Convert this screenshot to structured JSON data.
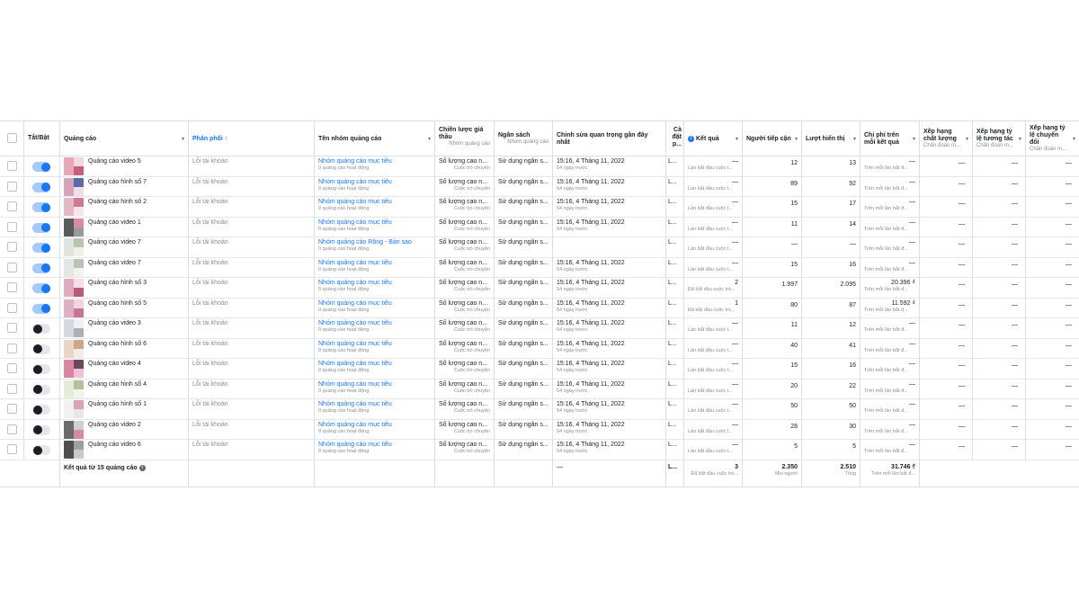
{
  "columns": {
    "toggle": "Tắt/Bật",
    "ad": "Quảng cáo",
    "delivery": "Phân phối ↑",
    "adset": "Tên nhóm quảng cáo",
    "bid": "Chiến lược giá thầu",
    "bid_sub": "Nhóm quảng cáo",
    "budget": "Ngân sách",
    "budget_sub": "Nhóm quảng cáo",
    "edited": "Chỉnh sửa quan trọng gần đây nhất",
    "attr_l1": "Cà",
    "attr_l2": "đặt",
    "attr_l3": "p...",
    "results": "Kết quả",
    "reach": "Người tiếp cận",
    "impressions": "Lượt hiển thị",
    "cpr": "Chi phí trên mỗi kết quả",
    "quality": "Xếp hạng chất lượng",
    "quality_sub": "Chẩn đoán m...",
    "engagement": "Xếp hạng tỷ lệ tương tác",
    "engagement_sub": "Chẩn đoán m...",
    "conversion": "Xếp hạng tỷ lệ chuyển đổi",
    "conversion_sub": "Chẩn đoán m..."
  },
  "common": {
    "delivery": "Lỗi tài khoản",
    "adset_sub": "0 quảng cáo hoạt động",
    "bid": "Số lượng cao n...",
    "bid_sub": "Cuộc trò chuyện",
    "budget": "Sử dụng ngân s...",
    "edited_date": "15:16, 4 Tháng 11, 2022",
    "edited_sub": "54 ngày trước",
    "attr": "L...",
    "results_sub": "Lần bắt đầu cuộc t...",
    "results_sub_alt": "Đã bắt đầu cuộc trò...",
    "cpr_sub": "Trên mỗi lần bắt đ...",
    "dash": "—"
  },
  "rows": [
    {
      "name": "Quảng cáo video 5",
      "on": true,
      "adset": "Nhóm quảng cáo mục tiêu",
      "edited": true,
      "results": "—",
      "alt": false,
      "reach": "12",
      "impr": "13",
      "cpr": "—",
      "t": [
        "#e8a5b4",
        "#f3d7de",
        "#c45f7d"
      ]
    },
    {
      "name": "Quảng cáo hình số 7",
      "on": true,
      "adset": "Nhóm quảng cáo mục tiêu",
      "edited": true,
      "results": "—",
      "alt": false,
      "reach": "89",
      "impr": "92",
      "cpr": "—",
      "t": [
        "#d7a3b8",
        "#5b6aa3",
        "#f0dde5"
      ]
    },
    {
      "name": "Quảng cáo hình số 2",
      "on": true,
      "adset": "Nhóm quảng cáo mục tiêu",
      "edited": true,
      "results": "—",
      "alt": false,
      "reach": "15",
      "impr": "17",
      "cpr": "—",
      "t": [
        "#e6b7c4",
        "#cf7b97",
        "#f5e4ea"
      ]
    },
    {
      "name": "Quảng cáo video 1",
      "on": true,
      "adset": "Nhóm quảng cáo mục tiêu",
      "edited": true,
      "results": "—",
      "alt": false,
      "reach": "11",
      "impr": "14",
      "cpr": "—",
      "t": [
        "#5a5a5a",
        "#d98aa5",
        "#9a9a9a"
      ]
    },
    {
      "name": "Quảng cáo video 7",
      "on": true,
      "adset": "Nhóm quảng cáo Rộng - Bản sao",
      "edited": false,
      "results": "—",
      "alt": false,
      "reach": "—",
      "impr": "—",
      "cpr": "—",
      "t": [
        "#dfe5dc",
        "#b7c6b0",
        "#eef0ea"
      ]
    },
    {
      "name": "Quảng cáo video 7",
      "on": true,
      "adset": "Nhóm quảng cáo mục tiêu",
      "edited": true,
      "results": "—",
      "alt": false,
      "reach": "15",
      "impr": "16",
      "cpr": "—",
      "t": [
        "#e4e7e1",
        "#b9c2b3",
        "#f2f3ef"
      ]
    },
    {
      "name": "Quảng cáo hình số 3",
      "on": true,
      "adset": "Nhóm quảng cáo mục tiêu",
      "edited": true,
      "results": "2",
      "alt": true,
      "reach": "1.997",
      "impr": "2.095",
      "cpr": "20.396 ₫",
      "t": [
        "#e2aabd",
        "#f4dde6",
        "#b85a7a"
      ]
    },
    {
      "name": "Quảng cáo hình số 5",
      "on": true,
      "adset": "Nhóm quảng cáo mục tiêu",
      "edited": true,
      "results": "1",
      "alt": true,
      "reach": "80",
      "impr": "87",
      "cpr": "11.592 ₫",
      "t": [
        "#dfb0c0",
        "#f1d4de",
        "#c87494"
      ]
    },
    {
      "name": "Quảng cáo video 3",
      "on": false,
      "adset": "Nhóm quảng cáo mục tiêu",
      "edited": true,
      "results": "—",
      "alt": false,
      "reach": "11",
      "impr": "12",
      "cpr": "—",
      "t": [
        "#d5d9dd",
        "#eef0f2",
        "#aab1b8"
      ]
    },
    {
      "name": "Quảng cáo hình số 6",
      "on": false,
      "adset": "Nhóm quảng cáo mục tiêu",
      "edited": true,
      "results": "—",
      "alt": false,
      "reach": "40",
      "impr": "41",
      "cpr": "—",
      "t": [
        "#e9d6c4",
        "#c9a78b",
        "#f4ece4"
      ]
    },
    {
      "name": "Quảng cáo video 4",
      "on": false,
      "adset": "Nhóm quảng cáo mục tiêu",
      "edited": true,
      "results": "—",
      "alt": false,
      "reach": "15",
      "impr": "16",
      "cpr": "—",
      "t": [
        "#d886a3",
        "#6b4a59",
        "#eec2d1"
      ]
    },
    {
      "name": "Quảng cáo hình số 4",
      "on": false,
      "adset": "Nhóm quảng cáo mục tiêu",
      "edited": true,
      "results": "—",
      "alt": false,
      "reach": "20",
      "impr": "22",
      "cpr": "—",
      "t": [
        "#e6ecd9",
        "#b3c29a",
        "#f3f5ec"
      ]
    },
    {
      "name": "Quảng cáo hình số 1",
      "on": false,
      "adset": "Nhóm quảng cáo mục tiêu",
      "edited": true,
      "results": "—",
      "alt": false,
      "reach": "50",
      "impr": "50",
      "cpr": "—",
      "t": [
        "#f1f1f1",
        "#d9a2b6",
        "#e6e6e6"
      ]
    },
    {
      "name": "Quảng cáo video 2",
      "on": false,
      "adset": "Nhóm quảng cáo mục tiêu",
      "edited": true,
      "results": "—",
      "alt": false,
      "reach": "28",
      "impr": "30",
      "cpr": "—",
      "t": [
        "#6b6b6b",
        "#cfcfcf",
        "#d88aa4"
      ]
    },
    {
      "name": "Quảng cáo video 6",
      "on": false,
      "adset": "Nhóm quảng cáo mục tiêu",
      "edited": true,
      "results": "—",
      "alt": false,
      "reach": "5",
      "impr": "5",
      "cpr": "—",
      "t": [
        "#4f4f4f",
        "#9f9f9f",
        "#c9c9c9"
      ]
    }
  ],
  "footer": {
    "summary": "Kết quả từ 15 quảng cáo",
    "edited": "—",
    "attr": "L...",
    "results": "3",
    "results_sub": "Đã bắt đầu cuộc trò...",
    "reach": "2.350",
    "reach_sub": "Mọi người",
    "impressions": "2.510",
    "impressions_sub": "Tổng",
    "cpr": "31.746 ₫",
    "cpr_sub": "Trên mỗi lần bắt đ..."
  },
  "colors": {
    "accent": "#1877f2",
    "toggle_on_track": "#a6c9fa",
    "link": "#1877f2",
    "muted": "#8a8d91"
  },
  "icons": {
    "info": "info-icon",
    "sort": "chevron-down-icon"
  }
}
